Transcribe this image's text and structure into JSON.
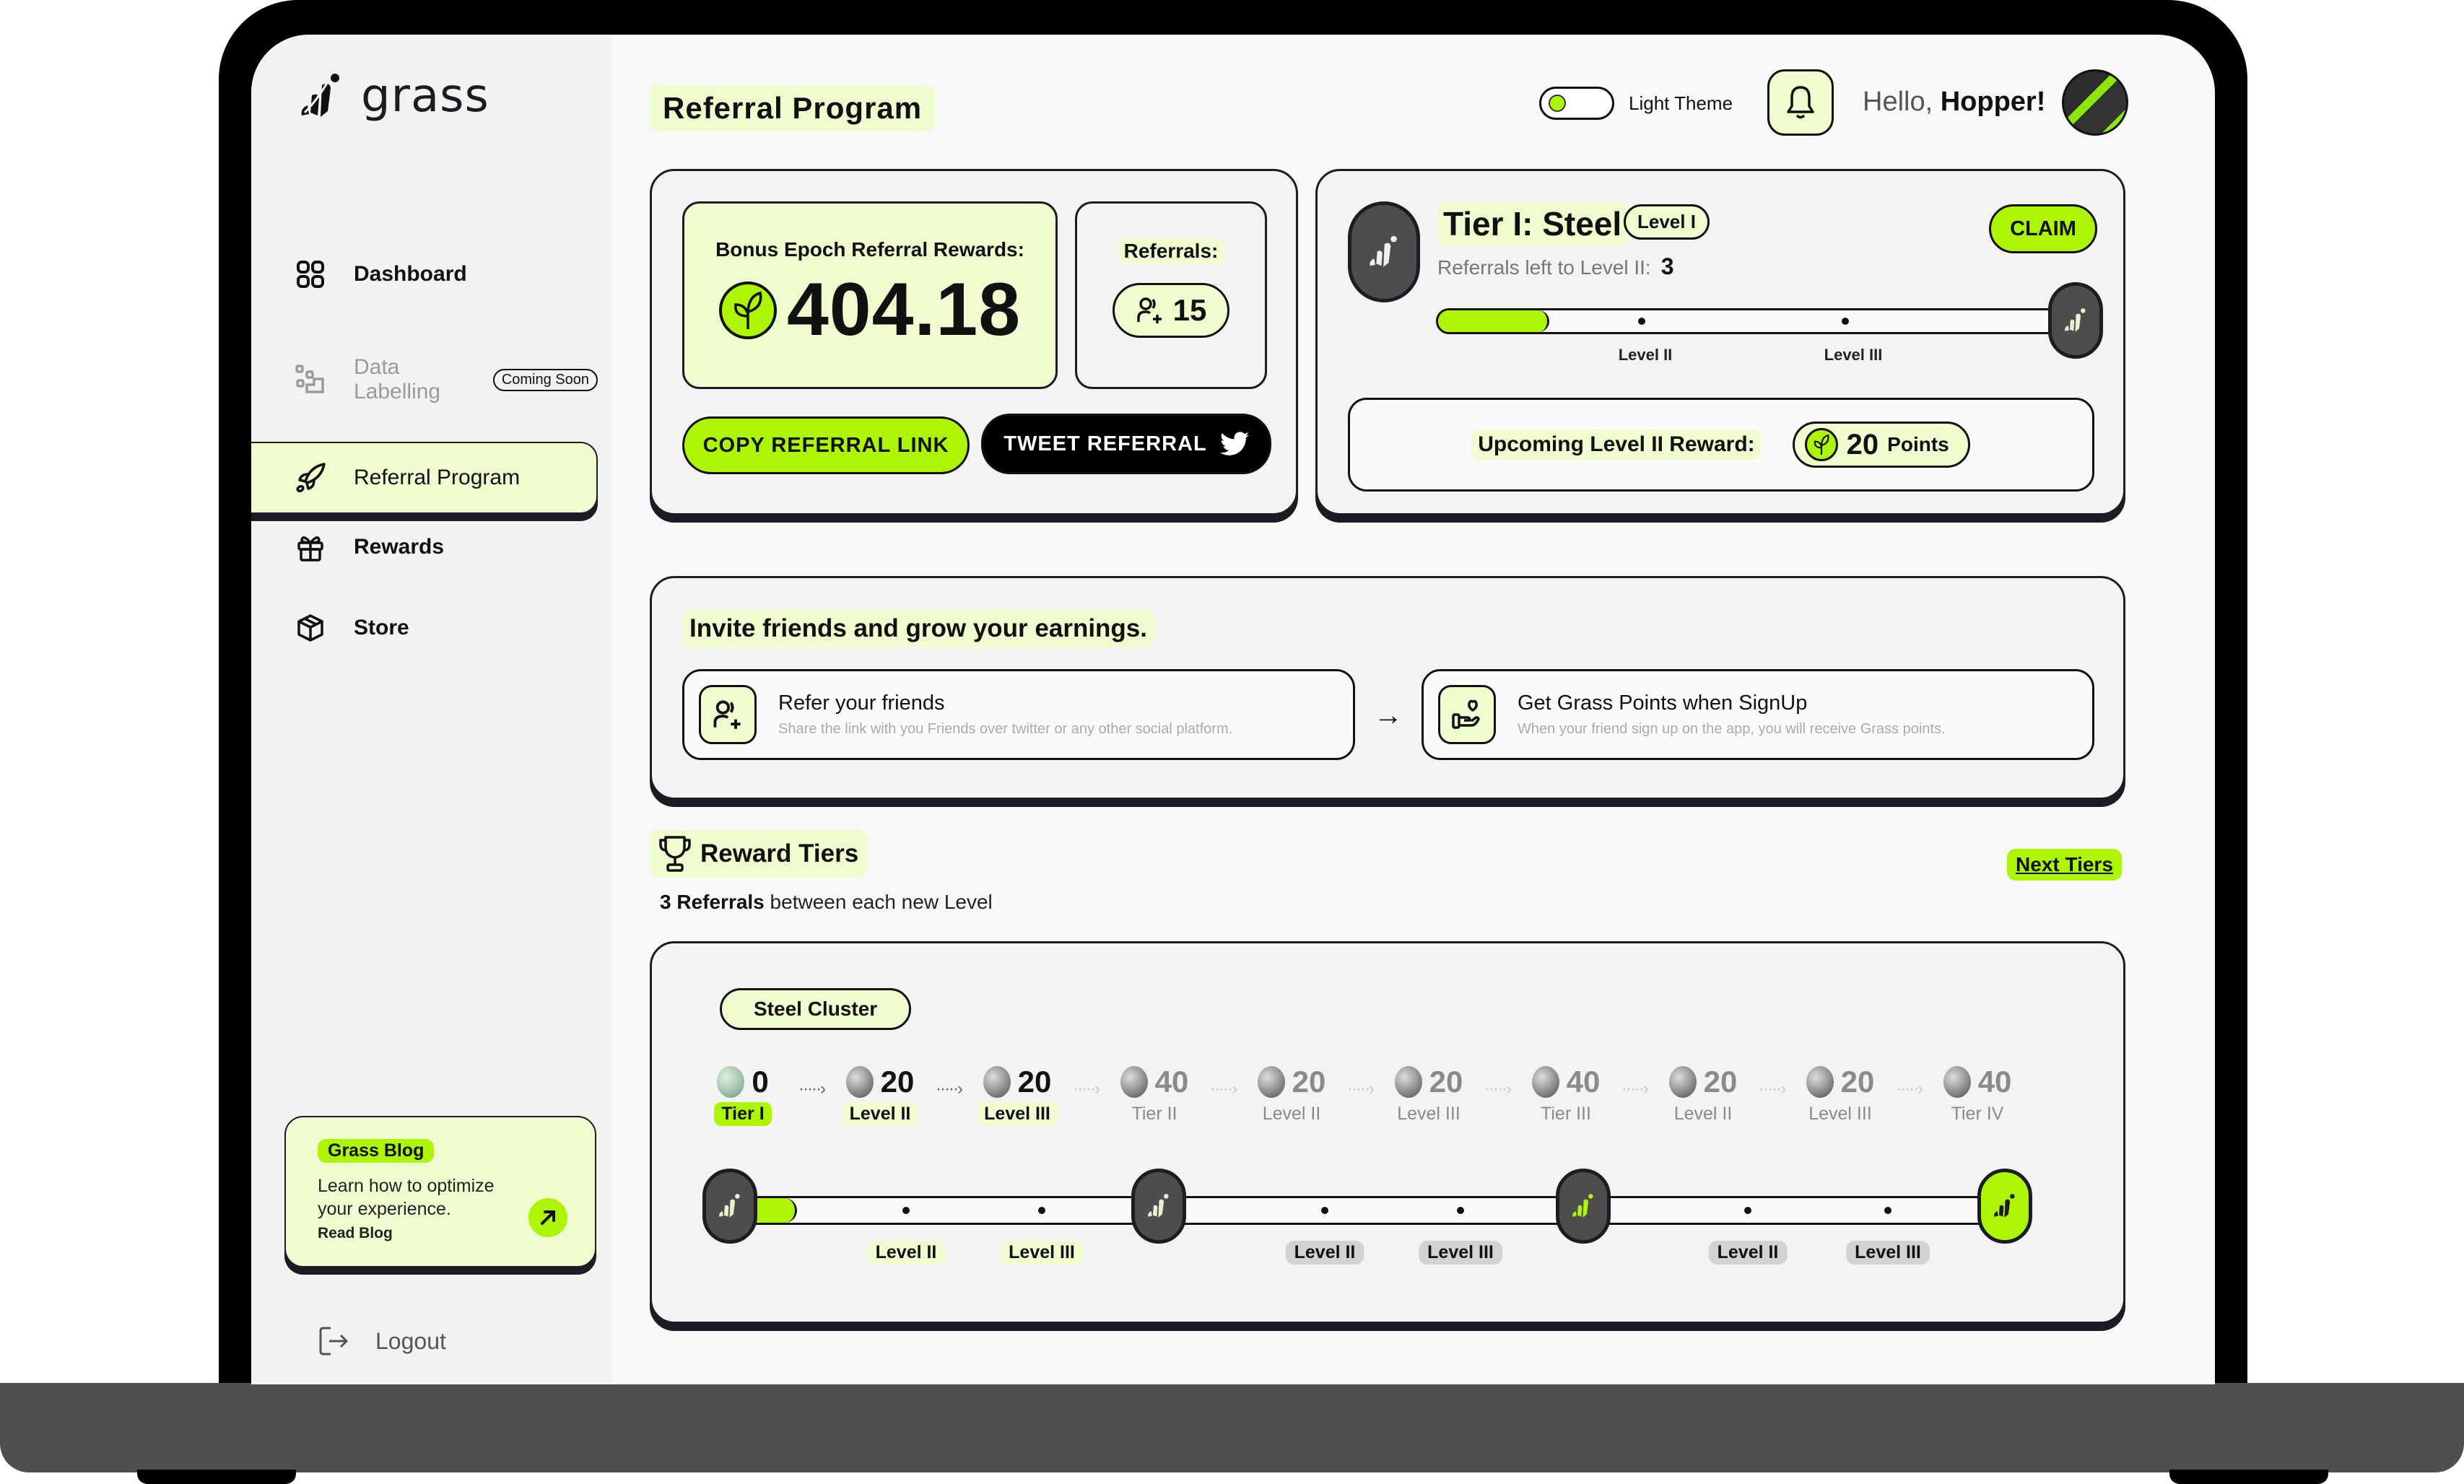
{
  "app": {
    "name": "grass"
  },
  "sidebar": {
    "items": [
      {
        "label": "Dashboard",
        "icon": "grid-icon",
        "state": "normal"
      },
      {
        "label": "Data Labelling",
        "icon": "data-labelling-icon",
        "state": "disabled",
        "badge": "Coming Soon"
      },
      {
        "label": "Referral Program",
        "icon": "rocket-icon",
        "state": "active"
      },
      {
        "label": "Rewards",
        "icon": "gift-icon",
        "state": "normal"
      },
      {
        "label": "Store",
        "icon": "box-icon",
        "state": "normal"
      }
    ],
    "data_labelling_line1": "Data",
    "data_labelling_line2": "Labelling",
    "blog": {
      "tag": "Grass Blog",
      "description": "Learn how to optimize your experience.",
      "link_label": "Read Blog"
    },
    "logout_label": "Logout"
  },
  "header": {
    "title": "Referral Program",
    "theme_label": "Light Theme",
    "greeting_prefix": "Hello,",
    "greeting_name": "Hopper!"
  },
  "bonus": {
    "label": "Bonus Epoch Referral Rewards:",
    "value": "404.18"
  },
  "referrals": {
    "label": "Referrals:",
    "count": "15"
  },
  "actions": {
    "copy_label": "COPY REFERRAL LINK",
    "tweet_label": "TWEET REFERRAL"
  },
  "tier": {
    "title": "Tier I: Steel",
    "level_chip": "Level I",
    "claim_label": "CLAIM",
    "referrals_left_label": "Referrals left to Level II:",
    "referrals_left": "3",
    "progress_fraction": 0.18,
    "progress_labels": [
      "Level II",
      "Level III"
    ],
    "upcoming_label": "Upcoming Level II Reward:",
    "upcoming_points": "20",
    "upcoming_unit": "Points"
  },
  "invite": {
    "title": "Invite friends and grow your earnings.",
    "steps": [
      {
        "title": "Refer your friends",
        "description": "Share the link with you Friends over twitter or any other social platform."
      },
      {
        "title": "Get Grass Points when SignUp",
        "description": "When your friend sign up on the app, you will receive Grass points."
      }
    ]
  },
  "reward_tiers": {
    "title": "Reward Tiers",
    "subtitle_bold": "3 Referrals",
    "subtitle_rest": "between each new Level",
    "next_label": "Next Tiers",
    "cluster": "Steel Cluster",
    "timeline": [
      {
        "value": "0",
        "label": "Tier I",
        "style": "current"
      },
      {
        "value": "20",
        "label": "Level II",
        "style": "active"
      },
      {
        "value": "20",
        "label": "Level III",
        "style": "active"
      },
      {
        "value": "40",
        "label": "Tier II",
        "style": "faded"
      },
      {
        "value": "20",
        "label": "Level II",
        "style": "faded"
      },
      {
        "value": "20",
        "label": "Level III",
        "style": "faded"
      },
      {
        "value": "40",
        "label": "Tier III",
        "style": "faded"
      },
      {
        "value": "20",
        "label": "Level II",
        "style": "faded"
      },
      {
        "value": "20",
        "label": "Level III",
        "style": "faded"
      },
      {
        "value": "40",
        "label": "Tier IV",
        "style": "faded"
      }
    ],
    "track_labels": [
      "Level II",
      "Level III",
      "Level II",
      "Level III",
      "Level II",
      "Level III"
    ],
    "track_progress_fraction": 0.05
  },
  "colors": {
    "accent": "#adf507",
    "accent_pale": "#f0fbd0",
    "ink": "#1c1c24",
    "badge_dark": "#4d4d4d"
  }
}
